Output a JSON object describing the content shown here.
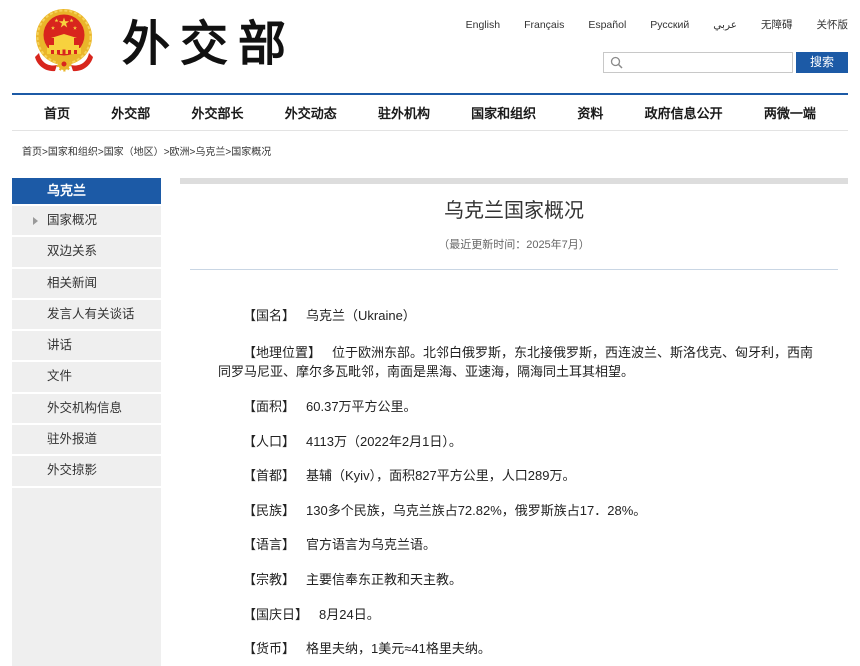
{
  "header": {
    "emblem_icon": "national-emblem-icon",
    "logo_text": "外交部",
    "languages": [
      "English",
      "Français",
      "Español",
      "Русский",
      "عربي",
      "无障碍",
      "关怀版"
    ],
    "search": {
      "icon": "search-icon",
      "button_label": "搜索"
    }
  },
  "nav": {
    "items": [
      "首页",
      "外交部",
      "外交部长",
      "外交动态",
      "驻外机构",
      "国家和组织",
      "资料",
      "政府信息公开",
      "两微一端"
    ]
  },
  "breadcrumb": {
    "separator": ">",
    "items": [
      "首页",
      "国家和组织",
      "国家（地区）",
      "欧洲",
      "乌克兰",
      "国家概况"
    ]
  },
  "sidebar": {
    "title": "乌克兰",
    "active_index": 0,
    "active_icon": "caret-right-icon",
    "items": [
      "国家概况",
      "双边关系",
      "相关新闻",
      "发言人有关谈话",
      "讲话",
      "文件",
      "外交机构信息",
      "驻外报道",
      "外交掠影"
    ]
  },
  "article": {
    "title": "乌克兰国家概况",
    "updated": "（最近更新时间：2025年7月）",
    "facts": [
      {
        "label": "【国名】",
        "value": "乌克兰（Ukraine）"
      },
      {
        "label": "【地理位置】",
        "value": "位于欧洲东部。北邻白俄罗斯，东北接俄罗斯，西连波兰、斯洛伐克、匈牙利，西南同罗马尼亚、摩尔多瓦毗邻，南面是黑海、亚速海，隔海同土耳其相望。"
      },
      {
        "label": "【面积】",
        "value": "60.37万平方公里。"
      },
      {
        "label": "【人口】",
        "value": "4113万（2022年2月1日）。"
      },
      {
        "label": "【首都】",
        "value": "基辅（Kyiv），面积827平方公里，人口289万。"
      },
      {
        "label": "【民族】",
        "value": "130多个民族，乌克兰族占72.82%，俄罗斯族占17．28%。"
      },
      {
        "label": "【语言】",
        "value": "官方语言为乌克兰语。"
      },
      {
        "label": "【宗教】",
        "value": "主要信奉东正教和天主教。"
      },
      {
        "label": "【国庆日】",
        "value": "8月24日。"
      },
      {
        "label": "【货币】",
        "value": "格里夫纳，1美元≈41格里夫纳。"
      }
    ]
  },
  "colors": {
    "brand_blue": "#1c5aa6",
    "sidebar_bg": "#efefef",
    "emblem_red": "#d8251d",
    "emblem_gold": "#eab52a"
  }
}
